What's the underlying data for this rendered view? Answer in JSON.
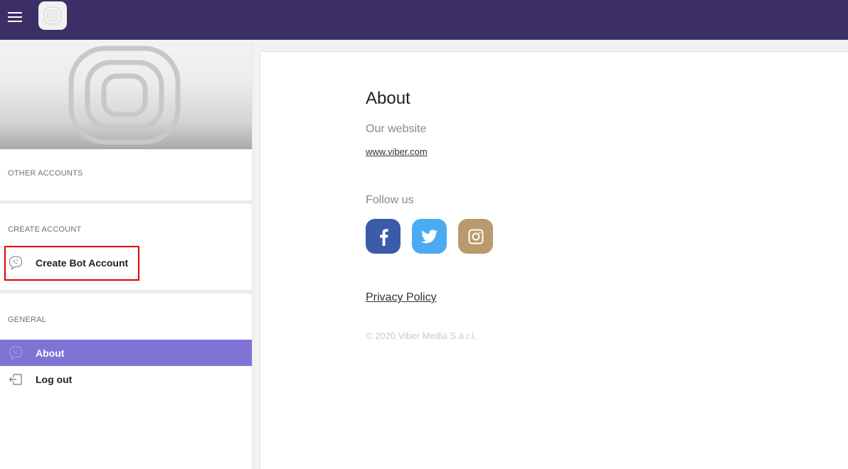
{
  "topbar": {
    "menu_icon": "hamburger-icon",
    "logo_icon": "viber-bot-logo-icon",
    "bg_color": "#3b2f65"
  },
  "sidebar": {
    "cover_icon": "viber-bot-placeholder-icon",
    "sections": {
      "other_accounts": "OTHER ACCOUNTS",
      "create_account": "CREATE ACCOUNT",
      "general": "GENERAL"
    },
    "create_bot": {
      "label": "Create Bot Account",
      "icon": "viber-icon"
    },
    "about": {
      "label": "About",
      "icon": "viber-icon",
      "active": true
    },
    "logout": {
      "label": "Log out",
      "icon": "logout-icon"
    },
    "active_color": "#7f73d5"
  },
  "main": {
    "title": "About",
    "website_heading": "Our website",
    "website_link": "www.viber.com",
    "follow_heading": "Follow us",
    "socials": [
      {
        "name": "facebook",
        "icon": "facebook-icon",
        "color": "#3b5ba8"
      },
      {
        "name": "twitter",
        "icon": "twitter-icon",
        "color": "#4aabf2"
      },
      {
        "name": "instagram",
        "icon": "instagram-icon",
        "color": "#b89a6c"
      }
    ],
    "privacy_link": "Privacy Policy",
    "copyright": "© 2020 Viber Media S.à r.l."
  }
}
